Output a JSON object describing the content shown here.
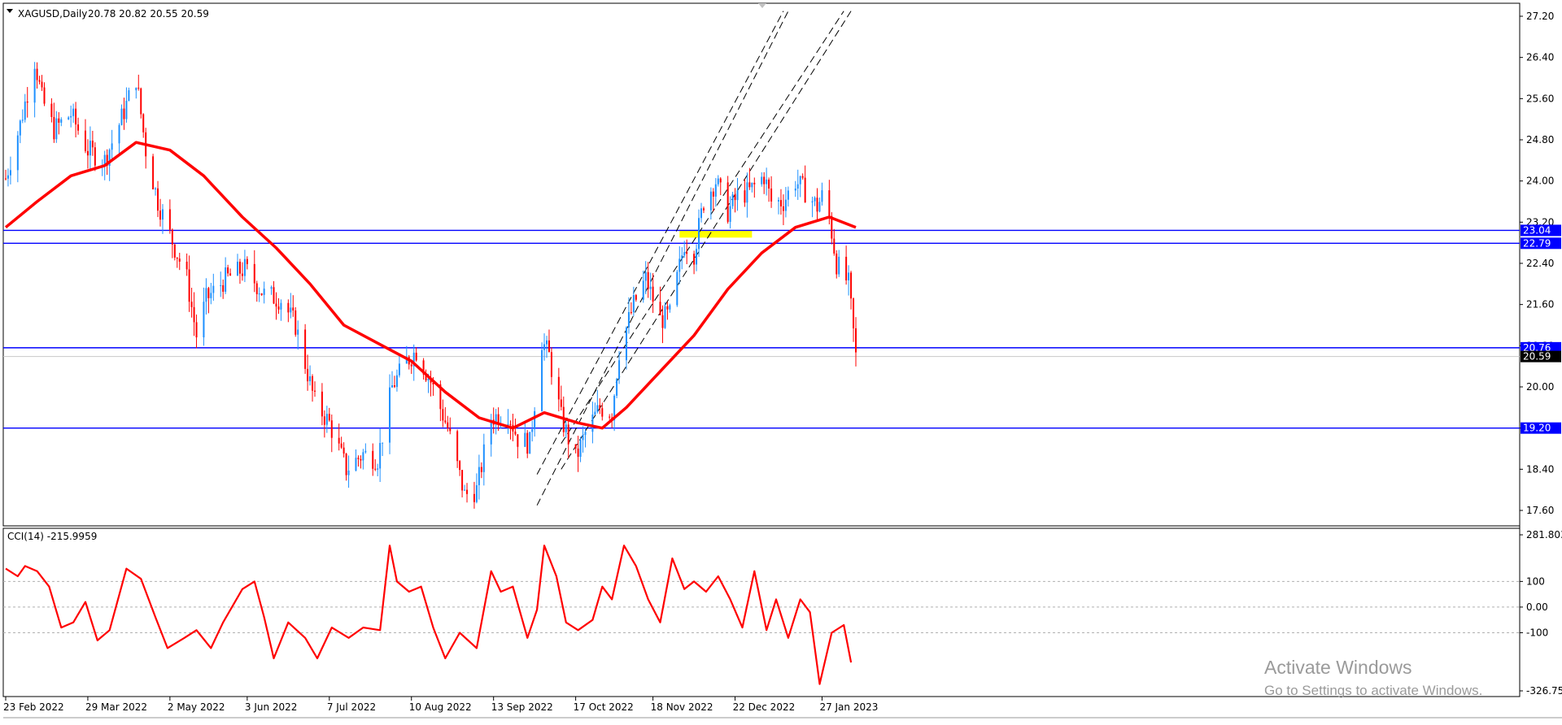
{
  "window": {
    "symbol_header": "XAGUSD,Daily",
    "ohlc": "20.78 20.82 20.55 20.59"
  },
  "colors": {
    "background": "#ffffff",
    "grid_border": "#000000",
    "price_level": "#0000ff",
    "moving_average": "#ff0000",
    "bull_candle": "#1e90ff",
    "bear_candle": "#ff0000",
    "zone": "#ffff00",
    "current_price_tag": "#000000",
    "cci_line": "#ff0000",
    "watermark": "#9a9a9a"
  },
  "chart_data": [
    {
      "type": "candlestick",
      "name": "XAGUSD Daily price",
      "x_tick_labels": [
        "23 Feb 2022",
        "29 Mar 2022",
        "2 May 2022",
        "3 Jun 2022",
        "7 Jul 2022",
        "10 Aug 2022",
        "13 Sep 2022",
        "17 Oct 2022",
        "18 Nov 2022",
        "22 Dec 2022",
        "27 Jan 2023"
      ],
      "y_tick_labels": [
        "27.20",
        "26.40",
        "25.60",
        "24.80",
        "24.00",
        "23.20",
        "22.40",
        "21.60",
        "20.80",
        "20.00",
        "19.20",
        "18.40",
        "17.60"
      ],
      "ylim": [
        17.6,
        27.2
      ],
      "x_range": [
        "2022-02-23",
        "2023-02-10"
      ],
      "horizontal_levels": [
        {
          "value": 23.04,
          "label": "23.04"
        },
        {
          "value": 22.79,
          "label": "22.79"
        },
        {
          "value": 20.76,
          "label": "20.76"
        },
        {
          "value": 19.2,
          "label": "19.20"
        }
      ],
      "current_price": {
        "value": 20.59,
        "label": "20.59"
      },
      "highlight_zone": {
        "from_date": "2022-11-29",
        "to_date": "2022-12-29",
        "y_low": 22.9,
        "y_high": 23.04
      },
      "trend_channels": [
        {
          "style": "dashed",
          "lines": [
            {
              "from": [
                "2022-10-01",
                18.3
              ],
              "to": [
                "2023-01-11",
                27.3
              ]
            },
            {
              "from": [
                "2022-10-01",
                17.7
              ],
              "to": [
                "2023-01-13",
                27.3
              ]
            }
          ]
        },
        {
          "style": "dashed",
          "lines": [
            {
              "from": [
                "2022-10-11",
                18.9
              ],
              "to": [
                "2023-02-05",
                27.3
              ]
            },
            {
              "from": [
                "2022-10-11",
                18.4
              ],
              "to": [
                "2023-02-08",
                27.3
              ]
            }
          ]
        }
      ],
      "series": [
        {
          "name": "close",
          "anchors": [
            [
              "2022-02-23",
              24.05
            ],
            [
              "2022-03-01",
              25.1
            ],
            [
              "2022-03-07",
              26.35
            ],
            [
              "2022-03-10",
              25.6
            ],
            [
              "2022-03-15",
              25.0
            ],
            [
              "2022-03-22",
              25.3
            ],
            [
              "2022-03-29",
              24.6
            ],
            [
              "2022-04-05",
              24.4
            ],
            [
              "2022-04-11",
              25.1
            ],
            [
              "2022-04-18",
              26.0
            ],
            [
              "2022-04-22",
              24.6
            ],
            [
              "2022-04-27",
              23.6
            ],
            [
              "2022-05-04",
              22.7
            ],
            [
              "2022-05-09",
              22.1
            ],
            [
              "2022-05-13",
              21.0
            ],
            [
              "2022-05-17",
              21.7
            ],
            [
              "2022-05-25",
              22.1
            ],
            [
              "2022-06-02",
              22.3
            ],
            [
              "2022-06-10",
              21.8
            ],
            [
              "2022-06-17",
              21.7
            ],
            [
              "2022-06-23",
              21.2
            ],
            [
              "2022-07-01",
              19.7
            ],
            [
              "2022-07-07",
              19.3
            ],
            [
              "2022-07-14",
              18.4
            ],
            [
              "2022-07-21",
              18.7
            ],
            [
              "2022-07-27",
              18.6
            ],
            [
              "2022-08-02",
              20.0
            ],
            [
              "2022-08-08",
              20.5
            ],
            [
              "2022-08-12",
              20.7
            ],
            [
              "2022-08-18",
              20.1
            ],
            [
              "2022-08-25",
              19.2
            ],
            [
              "2022-09-01",
              17.9
            ],
            [
              "2022-09-06",
              18.0
            ],
            [
              "2022-09-12",
              19.4
            ],
            [
              "2022-09-19",
              19.5
            ],
            [
              "2022-09-23",
              19.0
            ],
            [
              "2022-09-28",
              18.9
            ],
            [
              "2022-10-03",
              20.9
            ],
            [
              "2022-10-06",
              20.6
            ],
            [
              "2022-10-11",
              19.4
            ],
            [
              "2022-10-17",
              18.6
            ],
            [
              "2022-10-21",
              19.1
            ],
            [
              "2022-10-27",
              19.6
            ],
            [
              "2022-11-01",
              19.5
            ],
            [
              "2022-11-04",
              20.7
            ],
            [
              "2022-11-10",
              21.6
            ],
            [
              "2022-11-15",
              22.1
            ],
            [
              "2022-11-21",
              21.3
            ],
            [
              "2022-11-25",
              21.4
            ],
            [
              "2022-12-01",
              22.8
            ],
            [
              "2022-12-05",
              22.6
            ],
            [
              "2022-12-09",
              23.6
            ],
            [
              "2022-12-14",
              24.0
            ],
            [
              "2022-12-19",
              23.4
            ],
            [
              "2022-12-23",
              23.7
            ],
            [
              "2022-12-28",
              23.8
            ],
            [
              "2023-01-03",
              24.1
            ],
            [
              "2023-01-06",
              23.6
            ],
            [
              "2023-01-11",
              23.6
            ],
            [
              "2023-01-16",
              24.0
            ],
            [
              "2023-01-20",
              23.8
            ],
            [
              "2023-01-25",
              23.5
            ],
            [
              "2023-01-27",
              23.7
            ],
            [
              "2023-01-30",
              23.3
            ],
            [
              "2023-02-02",
              22.4
            ],
            [
              "2023-02-07",
              22.0
            ],
            [
              "2023-02-10",
              20.59
            ]
          ]
        },
        {
          "name": "moving average",
          "points": [
            [
              "2022-02-23",
              23.1
            ],
            [
              "2022-03-08",
              23.6
            ],
            [
              "2022-03-22",
              24.1
            ],
            [
              "2022-04-05",
              24.3
            ],
            [
              "2022-04-18",
              24.75
            ],
            [
              "2022-05-02",
              24.6
            ],
            [
              "2022-05-16",
              24.1
            ],
            [
              "2022-06-01",
              23.3
            ],
            [
              "2022-06-15",
              22.7
            ],
            [
              "2022-06-29",
              22.0
            ],
            [
              "2022-07-13",
              21.2
            ],
            [
              "2022-07-27",
              20.85
            ],
            [
              "2022-08-10",
              20.5
            ],
            [
              "2022-08-24",
              19.9
            ],
            [
              "2022-09-07",
              19.4
            ],
            [
              "2022-09-21",
              19.2
            ],
            [
              "2022-10-04",
              19.5
            ],
            [
              "2022-10-18",
              19.3
            ],
            [
              "2022-10-28",
              19.2
            ],
            [
              "2022-11-07",
              19.6
            ],
            [
              "2022-11-21",
              20.3
            ],
            [
              "2022-12-05",
              21.0
            ],
            [
              "2022-12-19",
              21.9
            ],
            [
              "2023-01-02",
              22.6
            ],
            [
              "2023-01-16",
              23.1
            ],
            [
              "2023-01-30",
              23.3
            ],
            [
              "2023-02-10",
              23.1
            ]
          ]
        }
      ]
    },
    {
      "type": "line",
      "name": "CCI(14)",
      "label": "CCI(14) -215.9959",
      "y_tick_labels": [
        "281.803",
        "100",
        "0.00",
        "-100",
        "-326.754"
      ],
      "ylim": [
        -326.754,
        281.803
      ],
      "reference_levels": [
        100,
        0,
        -100
      ],
      "series": [
        {
          "name": "CCI(14)",
          "points": [
            [
              "2022-02-23",
              150
            ],
            [
              "2022-02-28",
              120
            ],
            [
              "2022-03-03",
              160
            ],
            [
              "2022-03-08",
              140
            ],
            [
              "2022-03-13",
              80
            ],
            [
              "2022-03-18",
              -80
            ],
            [
              "2022-03-23",
              -60
            ],
            [
              "2022-03-28",
              20
            ],
            [
              "2022-04-02",
              -130
            ],
            [
              "2022-04-07",
              -90
            ],
            [
              "2022-04-14",
              150
            ],
            [
              "2022-04-20",
              110
            ],
            [
              "2022-04-26",
              -40
            ],
            [
              "2022-05-01",
              -160
            ],
            [
              "2022-05-08",
              -120
            ],
            [
              "2022-05-13",
              -90
            ],
            [
              "2022-05-19",
              -160
            ],
            [
              "2022-05-24",
              -60
            ],
            [
              "2022-06-01",
              70
            ],
            [
              "2022-06-06",
              100
            ],
            [
              "2022-06-10",
              -40
            ],
            [
              "2022-06-14",
              -200
            ],
            [
              "2022-06-20",
              -60
            ],
            [
              "2022-06-27",
              -120
            ],
            [
              "2022-07-02",
              -200
            ],
            [
              "2022-07-08",
              -80
            ],
            [
              "2022-07-15",
              -120
            ],
            [
              "2022-07-21",
              -80
            ],
            [
              "2022-07-28",
              -90
            ],
            [
              "2022-08-01",
              240
            ],
            [
              "2022-08-04",
              100
            ],
            [
              "2022-08-09",
              60
            ],
            [
              "2022-08-14",
              80
            ],
            [
              "2022-08-19",
              -80
            ],
            [
              "2022-08-24",
              -200
            ],
            [
              "2022-08-30",
              -100
            ],
            [
              "2022-09-06",
              -160
            ],
            [
              "2022-09-12",
              140
            ],
            [
              "2022-09-16",
              60
            ],
            [
              "2022-09-21",
              80
            ],
            [
              "2022-09-27",
              -120
            ],
            [
              "2022-10-01",
              -10
            ],
            [
              "2022-10-04",
              240
            ],
            [
              "2022-10-09",
              120
            ],
            [
              "2022-10-13",
              -60
            ],
            [
              "2022-10-18",
              -90
            ],
            [
              "2022-10-24",
              -50
            ],
            [
              "2022-10-28",
              80
            ],
            [
              "2022-11-01",
              30
            ],
            [
              "2022-11-06",
              240
            ],
            [
              "2022-11-11",
              160
            ],
            [
              "2022-11-16",
              30
            ],
            [
              "2022-11-21",
              -60
            ],
            [
              "2022-11-26",
              190
            ],
            [
              "2022-12-01",
              70
            ],
            [
              "2022-12-05",
              100
            ],
            [
              "2022-12-10",
              60
            ],
            [
              "2022-12-15",
              120
            ],
            [
              "2022-12-20",
              30
            ],
            [
              "2022-12-25",
              -80
            ],
            [
              "2022-12-30",
              140
            ],
            [
              "2023-01-04",
              -90
            ],
            [
              "2023-01-08",
              30
            ],
            [
              "2023-01-13",
              -120
            ],
            [
              "2023-01-18",
              30
            ],
            [
              "2023-01-22",
              -20
            ],
            [
              "2023-01-26",
              -300
            ],
            [
              "2023-01-31",
              -100
            ],
            [
              "2023-02-05",
              -70
            ],
            [
              "2023-02-08",
              -215.9959
            ]
          ]
        }
      ]
    }
  ],
  "price_axis_labels": {
    "levels": [
      "23.04",
      "22.79",
      "20.76",
      "19.20"
    ],
    "current": "20.59"
  },
  "watermark": {
    "title": "Activate Windows",
    "subtitle": "Go to Settings to activate Windows."
  }
}
